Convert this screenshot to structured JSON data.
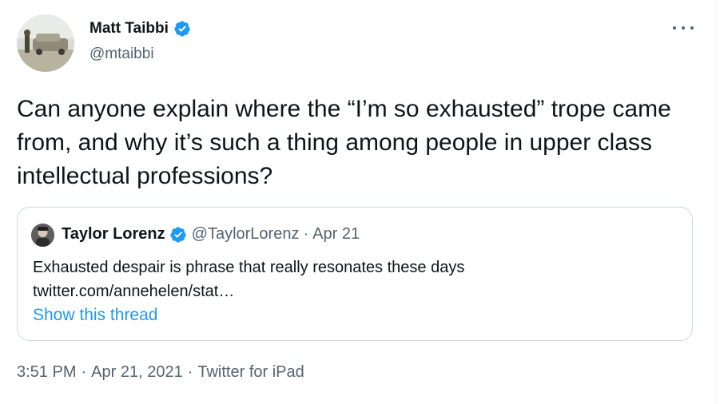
{
  "author": {
    "name": "Matt Taibbi",
    "handle": "@mtaibbi",
    "avatar_icon": "person-with-car-photo"
  },
  "tweet": {
    "text": "Can anyone explain where the “I’m so exhausted” trope came from, and why it’s such a thing among people in upper class intellectual professions?"
  },
  "quote": {
    "name": "Taylor Lorenz",
    "handle": "@TaylorLorenz",
    "separator": "·",
    "date": "Apr 21",
    "text_line1": "Exhausted despair is phrase that really resonates these days",
    "text_line2": "twitter.com/annehelen/stat…",
    "show_thread": "Show this thread"
  },
  "footer": {
    "time": "3:51 PM",
    "sep1": "·",
    "date": "Apr 21, 2021",
    "sep2": "·",
    "source": "Twitter for iPad"
  },
  "colors": {
    "verified": "#1d9bf0",
    "link": "#1d9bf0",
    "secondary_text": "#536471",
    "border": "#cfd9de"
  }
}
